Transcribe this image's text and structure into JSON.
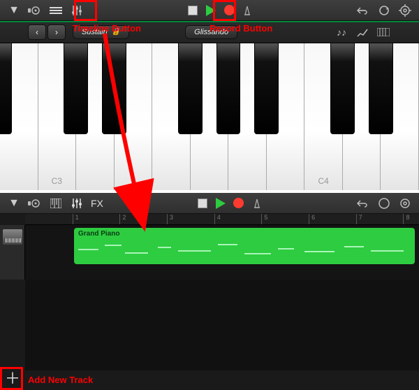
{
  "annotations": {
    "timeline_button": "Timeline Button",
    "record_button": "Record Button",
    "add_new_track": "Add New Track"
  },
  "screen1": {
    "toolbar": {
      "sustain_label": "Sustain",
      "glissando_label": "Glissando"
    },
    "key_labels": {
      "c3": "C3",
      "c4": "C4"
    }
  },
  "screen2": {
    "fx_label": "FX",
    "ruler_marks": [
      "1",
      "2",
      "3",
      "4",
      "5",
      "6",
      "7",
      "8"
    ],
    "region_name": "Grand Piano"
  }
}
